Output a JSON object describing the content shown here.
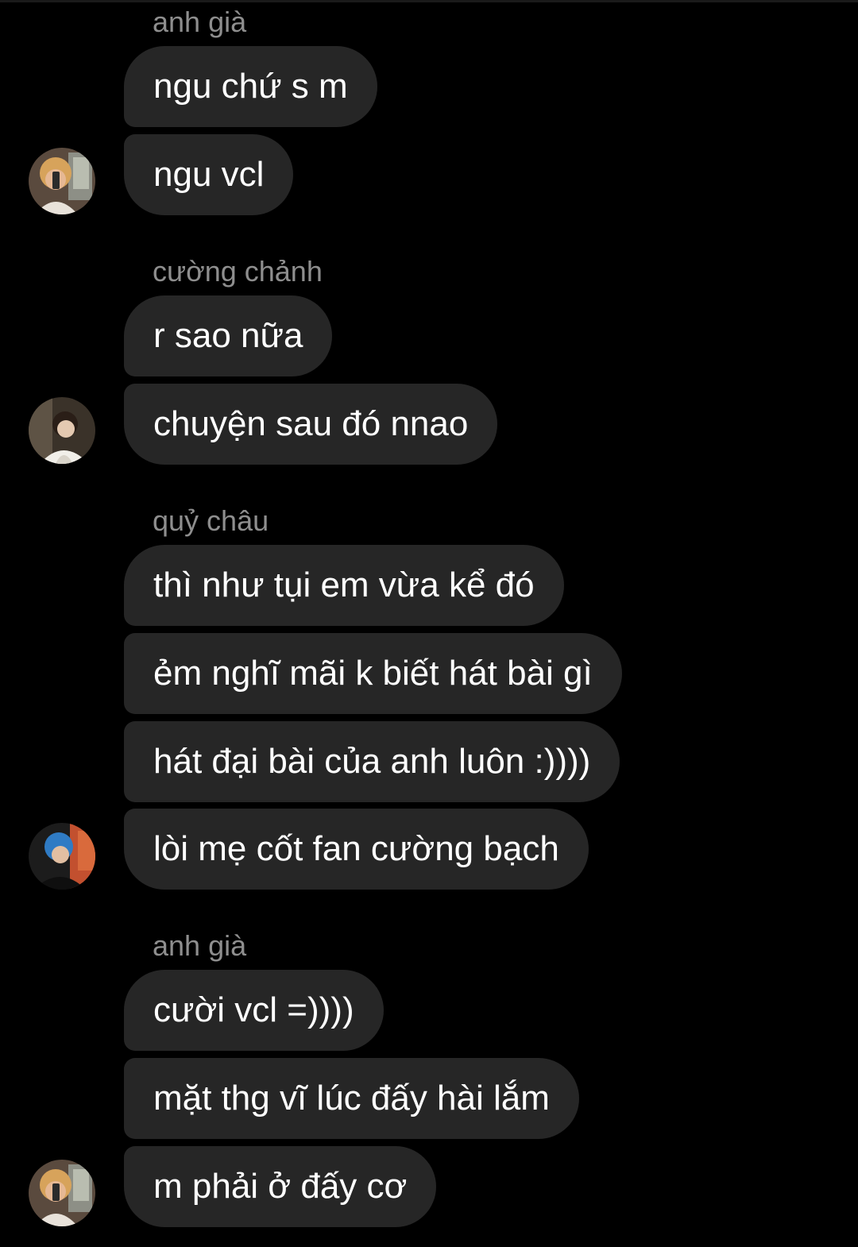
{
  "messages": [
    {
      "sender": "anh già",
      "lines": [
        "ngu chứ s m",
        "ngu vcl"
      ]
    },
    {
      "sender": "cường chảnh",
      "lines": [
        "r sao nữa",
        "chuyện sau đó nnao"
      ]
    },
    {
      "sender": "quỷ châu",
      "lines": [
        "thì như tụi em vừa kể đó",
        "ẻm nghĩ mãi k biết hát bài gì",
        "hát đại bài của anh luôn :))))",
        "lòi mẹ cốt fan cường bạch"
      ]
    },
    {
      "sender": "anh già",
      "lines": [
        "cười vcl =))))",
        "mặt thg vĩ lúc đấy hài lắm",
        "m phải ở đấy cơ"
      ]
    }
  ],
  "colors": {
    "background": "#000000",
    "bubble": "#262626",
    "text": "#ffffff",
    "sender_name": "#8e8e8e"
  }
}
